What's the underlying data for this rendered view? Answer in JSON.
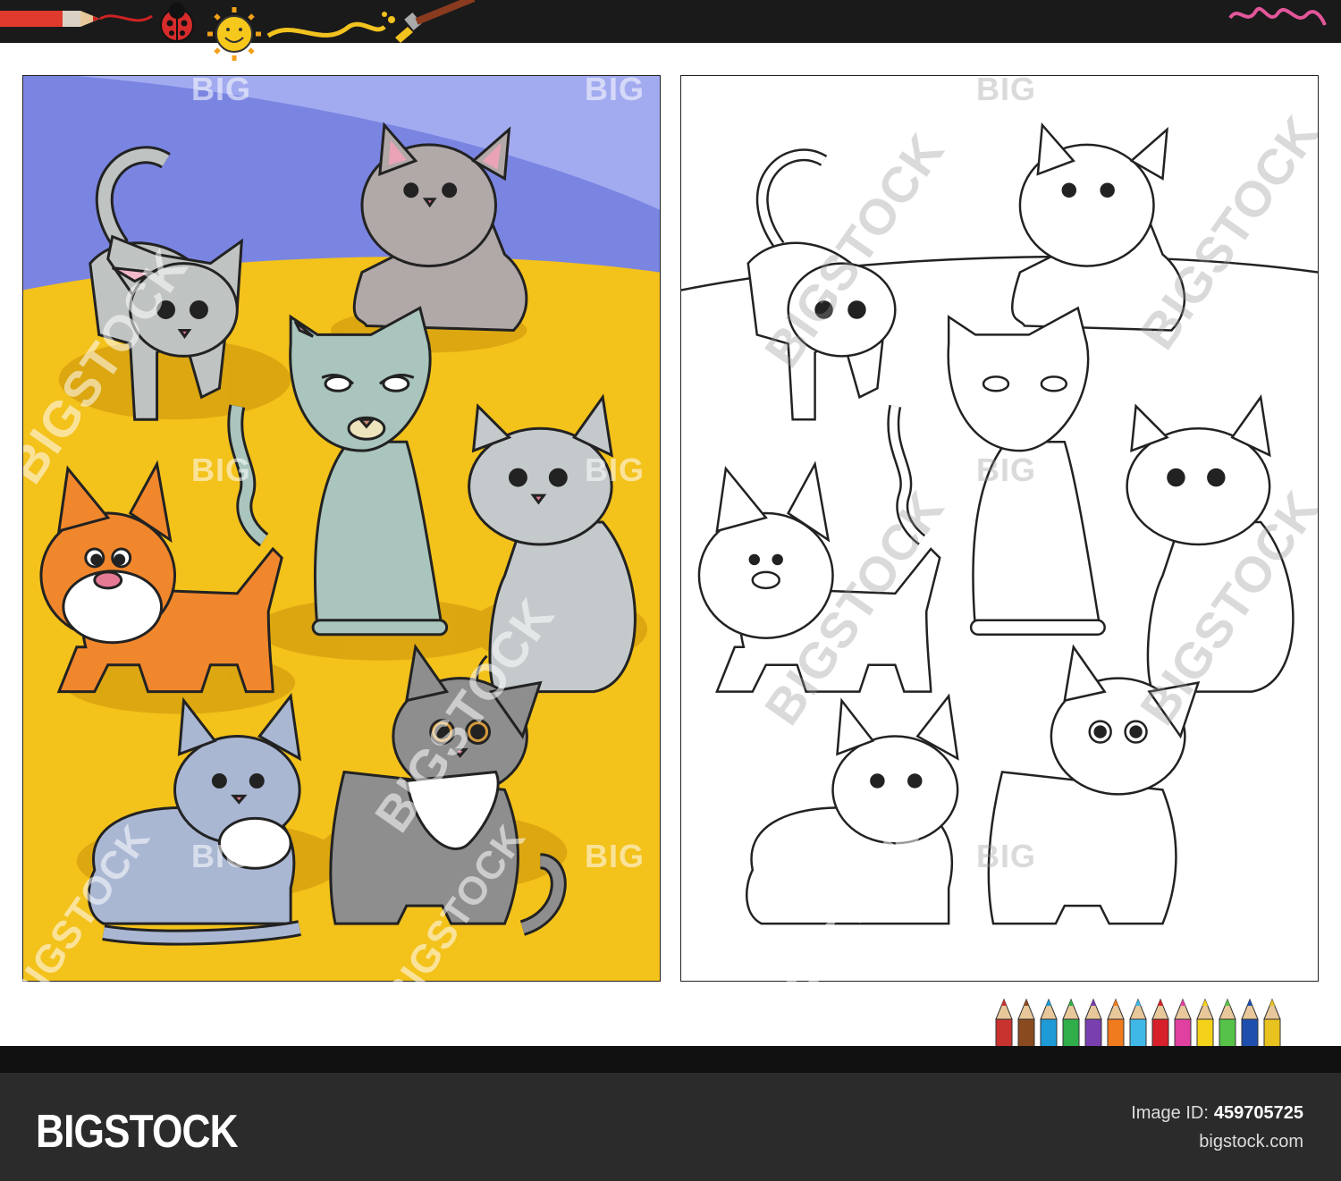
{
  "watermark": {
    "short": "BIG",
    "full": "BIGSTOCK"
  },
  "footer": {
    "brand": "BIGSTOCK",
    "image_id_label": "Image ID:",
    "image_id_value": "459705725",
    "site_url": "bigstock.com"
  },
  "colors": {
    "sky": "#8c93e8",
    "ground": "#f4c21a",
    "footer_bg": "#2b2b2b",
    "top_bar": "#1a1a1a"
  },
  "icons": [
    "pencil-icon",
    "ladybug-icon",
    "sun-icon",
    "paintbrush-icon",
    "squiggle-icon",
    "colored-pencils-icon"
  ]
}
